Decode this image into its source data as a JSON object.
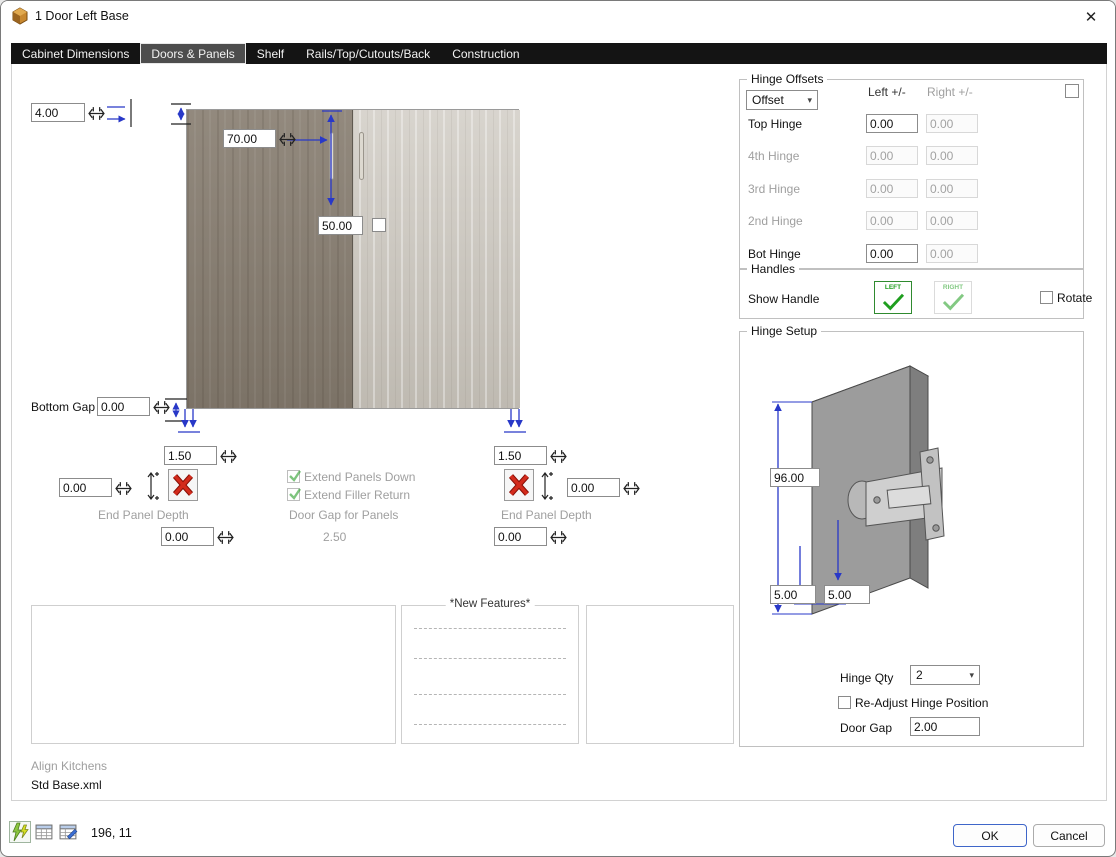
{
  "window": {
    "title": "1 Door Left Base",
    "close_glyph": "✕"
  },
  "tabs": {
    "items": [
      {
        "label": "Cabinet Dimensions"
      },
      {
        "label": "Doors & Panels"
      },
      {
        "label": "Shelf"
      },
      {
        "label": "Rails/Top/Cutouts/Back"
      },
      {
        "label": "Construction"
      }
    ]
  },
  "door_area": {
    "top_gap_value": "4.00",
    "handle_top_value": "70.00",
    "handle_mid_value": "50.00",
    "bottom_gap_label": "Bottom Gap",
    "bottom_gap_value": "0.00",
    "left_panel_thickness": "1.50",
    "right_panel_thickness": "1.50",
    "left_offset_value": "0.00",
    "right_offset_value": "0.00",
    "left_depth_label": "End Panel Depth",
    "right_depth_label": "End Panel Depth",
    "left_depth_value": "0.00",
    "right_depth_value": "0.00",
    "extend_panels_down_label": "Extend Panels Down",
    "extend_filler_return_label": "Extend Filler Return",
    "door_gap_panels_label": "Door Gap for Panels",
    "door_gap_panels_value": "2.50",
    "new_features_title": "*New Features*",
    "align_kitchens_label": "Align Kitchens",
    "template_file": "Std Base.xml"
  },
  "hinge_offsets": {
    "title": "Hinge Offsets",
    "mode_value": "Offset",
    "col_left_label": "Left +/-",
    "col_right_label": "Right +/-",
    "rows": [
      {
        "label": "Top Hinge",
        "left": "0.00",
        "right": "0.00"
      },
      {
        "label": "4th Hinge",
        "left": "0.00",
        "right": "0.00"
      },
      {
        "label": "3rd Hinge",
        "left": "0.00",
        "right": "0.00"
      },
      {
        "label": "2nd Hinge",
        "left": "0.00",
        "right": "0.00"
      },
      {
        "label": "Bot Hinge",
        "left": "0.00",
        "right": "0.00"
      }
    ]
  },
  "handles": {
    "title": "Handles",
    "show_handle_label": "Show Handle",
    "left_label": "LEFT",
    "right_label": "RIGHT",
    "rotate_label": "Rotate"
  },
  "hinge_setup": {
    "title": "Hinge Setup",
    "height_value": "96.00",
    "bottom_value": "5.00",
    "side_value": "5.00",
    "qty_label": "Hinge Qty",
    "qty_value": "2",
    "readjust_label": "Re-Adjust Hinge Position",
    "door_gap_label": "Door Gap",
    "door_gap_value": "2.00"
  },
  "statusbar": {
    "coords": "196, 11"
  },
  "actions": {
    "ok_label": "OK",
    "cancel_label": "Cancel"
  }
}
